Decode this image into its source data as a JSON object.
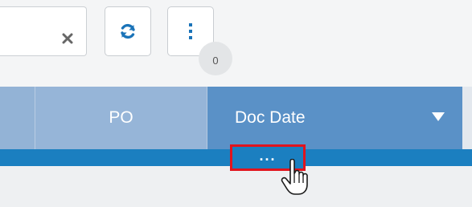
{
  "toolbar": {
    "search": {
      "value": ""
    },
    "clear_icon": "close-icon",
    "refresh_icon": "refresh-icon",
    "more_icon": "vertical-ellipsis-icon",
    "count_badge": "0"
  },
  "grid": {
    "columns": [
      {
        "label": ""
      },
      {
        "label": "PO"
      },
      {
        "label": "Doc Date",
        "sort_icon": "caret-down-icon"
      }
    ],
    "column_menu_label": "..."
  },
  "colors": {
    "header": "#7aa2cc",
    "active_header": "#5a91c7",
    "accent": "#1b7fc0",
    "highlight": "#e1141d"
  }
}
